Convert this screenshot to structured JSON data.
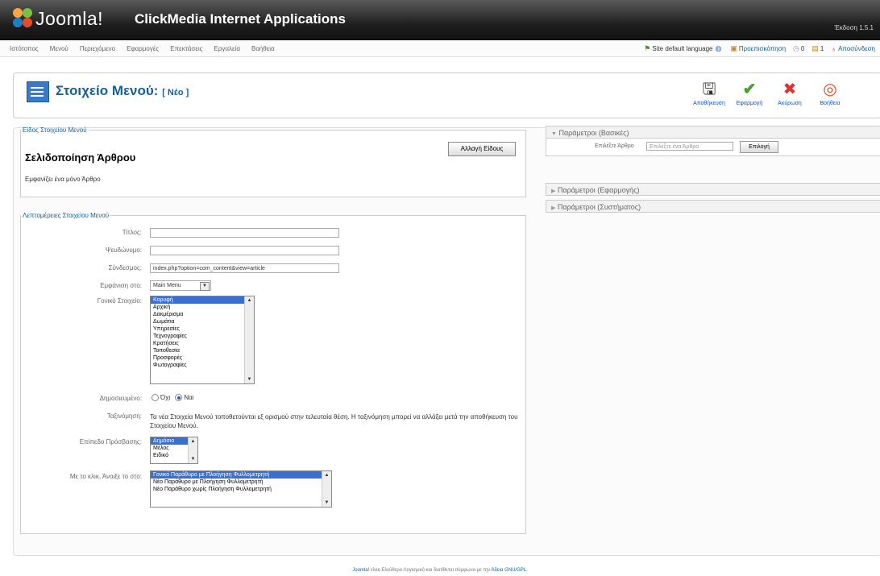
{
  "header": {
    "brand": "Joomla!",
    "site_name": "ClickMedia Internet Applications",
    "version": "Έκδοση 1.5.1"
  },
  "main_menu": [
    "Ιστότοπος",
    "Μενού",
    "Περιεχόμενο",
    "Εφαρμογές",
    "Επεκτάσεις",
    "Εργαλεία",
    "Βοήθεια"
  ],
  "status_bar": {
    "default_language": "Site default language",
    "preview": "Προεπισκόπηση",
    "messages": "0",
    "users": "1",
    "logout": "Αποσύνδεση"
  },
  "toolbar": {
    "title": "Στοιχείο Μενού:",
    "title_tag": "[ Νέο ]",
    "save": "Αποθήκευση",
    "apply": "Εφαρμογή",
    "cancel": "Ακύρωση",
    "help": "Βοήθεια"
  },
  "type_section": {
    "legend": "Είδος Στοιχείου Μενού",
    "title": "Σελιδοποίηση Άρθρου",
    "description": "Εμφανίζει ένα μόνο Άρθρο",
    "change_button": "Αλλαγή Είδους"
  },
  "details": {
    "legend": "Λεπτομέρειες Στοιχείου Μενού",
    "title_label": "Τίτλος:",
    "title_value": "",
    "alias_label": "Ψευδώνυμο:",
    "alias_value": "",
    "link_label": "Σύνδεσμος:",
    "link_value": "index.php?option=com_content&view=article",
    "display_in_label": "Εμφάνιση στο:",
    "display_in_value": "Main Menu",
    "parent_label": "Γονικό Στοιχείο:",
    "parent_options": [
      "Κορυφή",
      "Αρχική",
      "Δακμέρισμα",
      "Δωμάτια",
      "Υπηρεσίες",
      "Τεχνογραφίες",
      "Κρατήσεις",
      "Τοποθεσία",
      "Προσφορές",
      "Φωτογραφίες"
    ],
    "published_label": "Δημοσιευμένο:",
    "published_no": "Όχι",
    "published_yes": "Ναι",
    "order_label": "Ταξινόμηση:",
    "order_text": "Τα νέα Στοιχεία Μενού τοποθετούνται εξ ορισμού στην τελευταία θέση. Η ταξινόμηση μπορεί να αλλάξει μετά την αποθήκευση του Στοιχείου Μενού.",
    "access_label": "Επίπεδο Πρόσβασης:",
    "access_options": [
      "Δημόσιο",
      "Μέλος",
      "Ειδικό"
    ],
    "onclick_label": "Με το κλικ, Άνοιξε το στο:",
    "onclick_options": [
      "Γονικό Παράθυρο με Πλοήγηση Φυλλομετρητή",
      "Νέο Παράθυρο με Πλοήγηση Φυλλομετρητή",
      "Νέο Παράθυρο χωρίς Πλοήγηση Φυλλομετρητή"
    ]
  },
  "params": {
    "basic": "Παράμετροι (Βασικές)",
    "select_article_label": "Επιλέξτε Άρθρο",
    "select_article_placeholder": "Επιλέξτε ένα Άρθρο",
    "select_button": "Επιλογή",
    "component": "Παράμετροι (Εφαρμογής)",
    "system": "Παράμετροι (Συστήματος)"
  },
  "footer": {
    "joomla": "Joomla!",
    "text": " είναι Ελεύθερο Λογισμικό και διατίθεται σύμφωνα με την ",
    "license": "Άδεια GNU/GPL."
  }
}
